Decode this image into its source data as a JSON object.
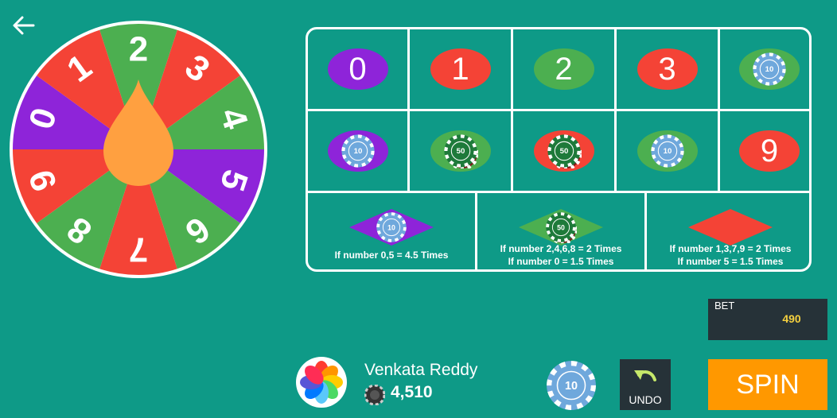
{
  "colors": {
    "background": "#0e9a87",
    "red": "#f44336",
    "green": "#4caf50",
    "purple": "#8e24d9",
    "orange_drop": "#ffa040",
    "chip_blue": "#6fa8dc",
    "chip_green": "#1e7a3a",
    "spin": "#ff9800",
    "bet_box": "#263238",
    "bet_value": "#f4d03f"
  },
  "wheel": {
    "segments": [
      {
        "number": "2",
        "color": "green"
      },
      {
        "number": "3",
        "color": "red"
      },
      {
        "number": "4",
        "color": "green"
      },
      {
        "number": "5",
        "color": "purple"
      },
      {
        "number": "6",
        "color": "green"
      },
      {
        "number": "7",
        "color": "red"
      },
      {
        "number": "8",
        "color": "green"
      },
      {
        "number": "9",
        "color": "red"
      },
      {
        "number": "0",
        "color": "purple"
      },
      {
        "number": "1",
        "color": "red"
      }
    ]
  },
  "board": {
    "numbers": [
      {
        "label": "0",
        "color": "purple",
        "chip": ""
      },
      {
        "label": "1",
        "color": "red",
        "chip": ""
      },
      {
        "label": "2",
        "color": "green",
        "chip": ""
      },
      {
        "label": "3",
        "color": "red",
        "chip": ""
      },
      {
        "label": "",
        "color": "green",
        "chip": "10"
      },
      {
        "label": "",
        "color": "purple",
        "chip": "10"
      },
      {
        "label": "",
        "color": "green",
        "chip": "50"
      },
      {
        "label": "",
        "color": "red",
        "chip": "50"
      },
      {
        "label": "",
        "color": "green",
        "chip": "10"
      },
      {
        "label": "9",
        "color": "red",
        "chip": ""
      }
    ],
    "bets": [
      {
        "color": "purple",
        "chip": "10",
        "line1": "If number 0,5 = 4.5 Times",
        "line2": ""
      },
      {
        "color": "green",
        "chip": "50",
        "line1": "If number 2,4,6,8 = 2 Times",
        "line2": "If number 0 = 1.5 Times"
      },
      {
        "color": "red",
        "chip": "",
        "line1": "If number 1,3,7,9 = 2 Times",
        "line2": "If number 5 = 1.5 Times"
      }
    ]
  },
  "bet": {
    "label": "BET",
    "value": "490"
  },
  "player": {
    "name": "Venkata Reddy",
    "coins": "4,510"
  },
  "selected_chip": "10",
  "undo_label": "UNDO",
  "spin_label": "SPIN",
  "icons": {
    "back": "back-arrow-icon",
    "avatar": "pinwheel-avatar-icon",
    "coin": "coin-icon",
    "undo": "undo-arrow-icon"
  }
}
